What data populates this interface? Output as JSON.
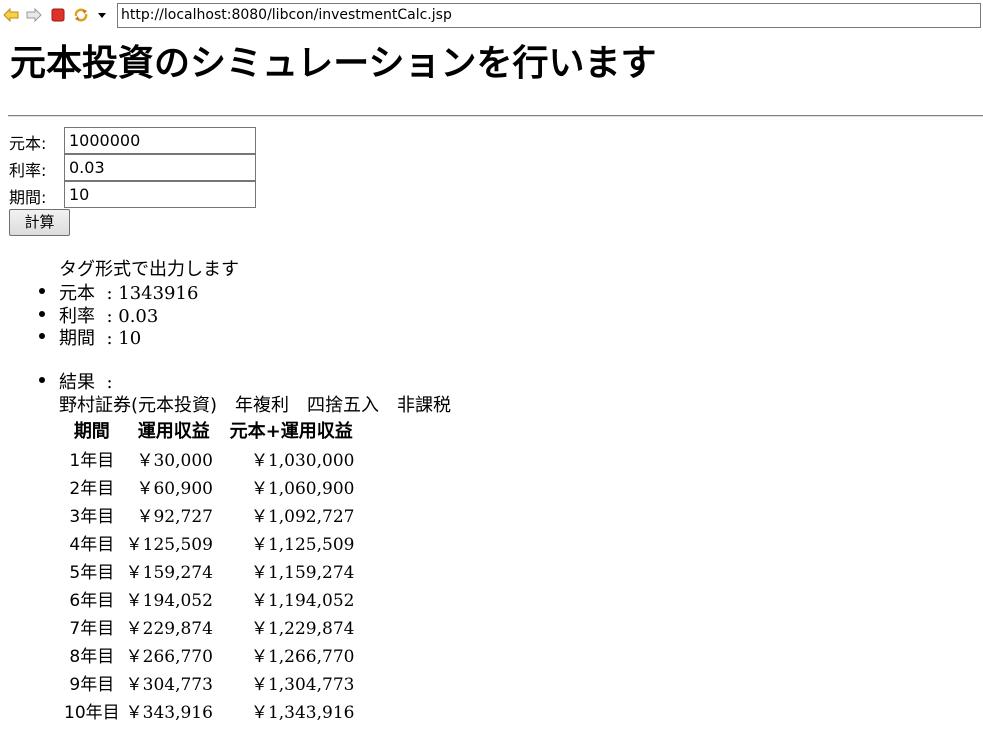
{
  "browser": {
    "url": "http://localhost:8080/libcon/investmentCalc.jsp",
    "icons": [
      "back-arrow-icon",
      "forward-arrow-icon",
      "stop-icon",
      "refresh-icon",
      "dropdown-arrow-icon"
    ]
  },
  "page": {
    "title": "元本投資のシミュレーションを行います"
  },
  "form": {
    "principal_label": "元本:",
    "principal_value": "1000000",
    "rate_label": "利率:",
    "rate_value": "0.03",
    "period_label": "期間:",
    "period_value": "10",
    "calc_button": "計算"
  },
  "output": {
    "intro": "タグ形式で出力します",
    "items": [
      {
        "label": "元本",
        "value": ": 1343916"
      },
      {
        "label": "利率",
        "value": ": 0.03"
      },
      {
        "label": "期間",
        "value": ": 10"
      }
    ],
    "result_label": "結果",
    "result_colon": ":",
    "result_desc": "野村証券(元本投資)　年複利　四捨五入　非課税"
  },
  "table": {
    "headers": [
      "期間",
      "運用収益",
      "元本+運用収益"
    ],
    "rows": [
      {
        "year": "1年目",
        "gain": "￥30,000",
        "total": "￥1,030,000"
      },
      {
        "year": "2年目",
        "gain": "￥60,900",
        "total": "￥1,060,900"
      },
      {
        "year": "3年目",
        "gain": "￥92,727",
        "total": "￥1,092,727"
      },
      {
        "year": "4年目",
        "gain": "￥125,509",
        "total": "￥1,125,509"
      },
      {
        "year": "5年目",
        "gain": "￥159,274",
        "total": "￥1,159,274"
      },
      {
        "year": "6年目",
        "gain": "￥194,052",
        "total": "￥1,194,052"
      },
      {
        "year": "7年目",
        "gain": "￥229,874",
        "total": "￥1,229,874"
      },
      {
        "year": "8年目",
        "gain": "￥266,770",
        "total": "￥1,266,770"
      },
      {
        "year": "9年目",
        "gain": "￥304,773",
        "total": "￥1,304,773"
      },
      {
        "year": "10年目",
        "gain": "￥343,916",
        "total": "￥1,343,916"
      }
    ]
  }
}
